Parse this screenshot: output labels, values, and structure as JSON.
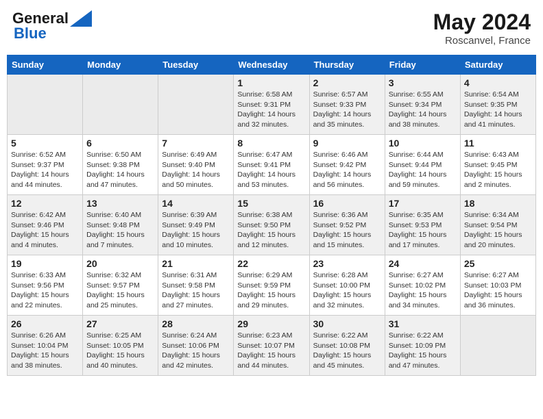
{
  "header": {
    "logo_line1": "General",
    "logo_line2": "Blue",
    "month": "May 2024",
    "location": "Roscanvel, France"
  },
  "weekdays": [
    "Sunday",
    "Monday",
    "Tuesday",
    "Wednesday",
    "Thursday",
    "Friday",
    "Saturday"
  ],
  "weeks": [
    [
      {
        "day": "",
        "info": ""
      },
      {
        "day": "",
        "info": ""
      },
      {
        "day": "",
        "info": ""
      },
      {
        "day": "1",
        "info": "Sunrise: 6:58 AM\nSunset: 9:31 PM\nDaylight: 14 hours\nand 32 minutes."
      },
      {
        "day": "2",
        "info": "Sunrise: 6:57 AM\nSunset: 9:33 PM\nDaylight: 14 hours\nand 35 minutes."
      },
      {
        "day": "3",
        "info": "Sunrise: 6:55 AM\nSunset: 9:34 PM\nDaylight: 14 hours\nand 38 minutes."
      },
      {
        "day": "4",
        "info": "Sunrise: 6:54 AM\nSunset: 9:35 PM\nDaylight: 14 hours\nand 41 minutes."
      }
    ],
    [
      {
        "day": "5",
        "info": "Sunrise: 6:52 AM\nSunset: 9:37 PM\nDaylight: 14 hours\nand 44 minutes."
      },
      {
        "day": "6",
        "info": "Sunrise: 6:50 AM\nSunset: 9:38 PM\nDaylight: 14 hours\nand 47 minutes."
      },
      {
        "day": "7",
        "info": "Sunrise: 6:49 AM\nSunset: 9:40 PM\nDaylight: 14 hours\nand 50 minutes."
      },
      {
        "day": "8",
        "info": "Sunrise: 6:47 AM\nSunset: 9:41 PM\nDaylight: 14 hours\nand 53 minutes."
      },
      {
        "day": "9",
        "info": "Sunrise: 6:46 AM\nSunset: 9:42 PM\nDaylight: 14 hours\nand 56 minutes."
      },
      {
        "day": "10",
        "info": "Sunrise: 6:44 AM\nSunset: 9:44 PM\nDaylight: 14 hours\nand 59 minutes."
      },
      {
        "day": "11",
        "info": "Sunrise: 6:43 AM\nSunset: 9:45 PM\nDaylight: 15 hours\nand 2 minutes."
      }
    ],
    [
      {
        "day": "12",
        "info": "Sunrise: 6:42 AM\nSunset: 9:46 PM\nDaylight: 15 hours\nand 4 minutes."
      },
      {
        "day": "13",
        "info": "Sunrise: 6:40 AM\nSunset: 9:48 PM\nDaylight: 15 hours\nand 7 minutes."
      },
      {
        "day": "14",
        "info": "Sunrise: 6:39 AM\nSunset: 9:49 PM\nDaylight: 15 hours\nand 10 minutes."
      },
      {
        "day": "15",
        "info": "Sunrise: 6:38 AM\nSunset: 9:50 PM\nDaylight: 15 hours\nand 12 minutes."
      },
      {
        "day": "16",
        "info": "Sunrise: 6:36 AM\nSunset: 9:52 PM\nDaylight: 15 hours\nand 15 minutes."
      },
      {
        "day": "17",
        "info": "Sunrise: 6:35 AM\nSunset: 9:53 PM\nDaylight: 15 hours\nand 17 minutes."
      },
      {
        "day": "18",
        "info": "Sunrise: 6:34 AM\nSunset: 9:54 PM\nDaylight: 15 hours\nand 20 minutes."
      }
    ],
    [
      {
        "day": "19",
        "info": "Sunrise: 6:33 AM\nSunset: 9:56 PM\nDaylight: 15 hours\nand 22 minutes."
      },
      {
        "day": "20",
        "info": "Sunrise: 6:32 AM\nSunset: 9:57 PM\nDaylight: 15 hours\nand 25 minutes."
      },
      {
        "day": "21",
        "info": "Sunrise: 6:31 AM\nSunset: 9:58 PM\nDaylight: 15 hours\nand 27 minutes."
      },
      {
        "day": "22",
        "info": "Sunrise: 6:29 AM\nSunset: 9:59 PM\nDaylight: 15 hours\nand 29 minutes."
      },
      {
        "day": "23",
        "info": "Sunrise: 6:28 AM\nSunset: 10:00 PM\nDaylight: 15 hours\nand 32 minutes."
      },
      {
        "day": "24",
        "info": "Sunrise: 6:27 AM\nSunset: 10:02 PM\nDaylight: 15 hours\nand 34 minutes."
      },
      {
        "day": "25",
        "info": "Sunrise: 6:27 AM\nSunset: 10:03 PM\nDaylight: 15 hours\nand 36 minutes."
      }
    ],
    [
      {
        "day": "26",
        "info": "Sunrise: 6:26 AM\nSunset: 10:04 PM\nDaylight: 15 hours\nand 38 minutes."
      },
      {
        "day": "27",
        "info": "Sunrise: 6:25 AM\nSunset: 10:05 PM\nDaylight: 15 hours\nand 40 minutes."
      },
      {
        "day": "28",
        "info": "Sunrise: 6:24 AM\nSunset: 10:06 PM\nDaylight: 15 hours\nand 42 minutes."
      },
      {
        "day": "29",
        "info": "Sunrise: 6:23 AM\nSunset: 10:07 PM\nDaylight: 15 hours\nand 44 minutes."
      },
      {
        "day": "30",
        "info": "Sunrise: 6:22 AM\nSunset: 10:08 PM\nDaylight: 15 hours\nand 45 minutes."
      },
      {
        "day": "31",
        "info": "Sunrise: 6:22 AM\nSunset: 10:09 PM\nDaylight: 15 hours\nand 47 minutes."
      },
      {
        "day": "",
        "info": ""
      }
    ]
  ]
}
